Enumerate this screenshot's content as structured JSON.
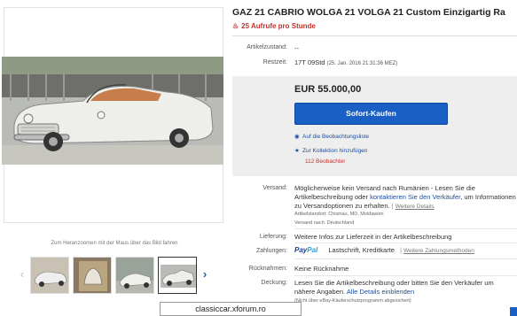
{
  "listing": {
    "title": "GAZ 21 CABRIO WOLGA 21 VOLGA 21 Custom Einzigartig Ra",
    "hot_text": "25 Aufrufe pro Stunde"
  },
  "details": {
    "condition_label": "Artikelzustand:",
    "condition_value": "--",
    "remaining_label": "Restzeit:",
    "remaining_value": "17T 09Std",
    "remaining_date": "(25. Jan. 2016   21:31:36 MEZ)"
  },
  "buy": {
    "price": "EUR 55.000,00",
    "buy_button": "Sofort-Kaufen",
    "watch_link": "Auf die Beobachtungsliste",
    "collection_link": "Zur Kollektion hinzufügen",
    "watchers": "112 Beobachter"
  },
  "shipping": {
    "label": "Versand:",
    "text_pre": "Möglicherweise kein Versand nach Rumänien - Lesen Sie die Artikelbeschreibung oder ",
    "contact_link": "kontaktieren Sie den Verkäufer",
    "text_post": ", um Informationen zu Versandoptionen zu erhalten.",
    "more_link": "Weitere Details",
    "location": "Artikelstandort: Chisinau, MD, Moldawien",
    "ships_to": "Versand nach: Deutschland"
  },
  "delivery": {
    "label": "Lieferung:",
    "value": "Weitere Infos zur Lieferzeit in der Artikelbeschreibung"
  },
  "payments": {
    "label": "Zahlungen:",
    "paypal_a": "Pay",
    "paypal_b": "Pal",
    "methods": "Lastschrift,  Kreditkarte",
    "more_link": "Weitere Zahlungsmethoden"
  },
  "returns": {
    "label": "Rücknahmen:",
    "value": "Keine Rücknahme"
  },
  "coverage": {
    "label": "Deckung:",
    "text": "Lesen Sie die Artikelbeschreibung oder bitten Sie den Verkäufer um nähere Angaben.",
    "link": "Alle Details einblenden",
    "note": "(Nicht über eBay-Käuferschutzprogramm abgesichert)"
  },
  "gallery": {
    "zoom_hint": "Zum Heranzoomen mit der Maus über das Bild fahren",
    "thumbnails": 4,
    "active_thumbnail": 4
  },
  "watermark": "classiccar.xforum.ro",
  "colors": {
    "accent": "#1a5fc3",
    "link": "#1a4fa3",
    "alert": "#c4302b"
  }
}
